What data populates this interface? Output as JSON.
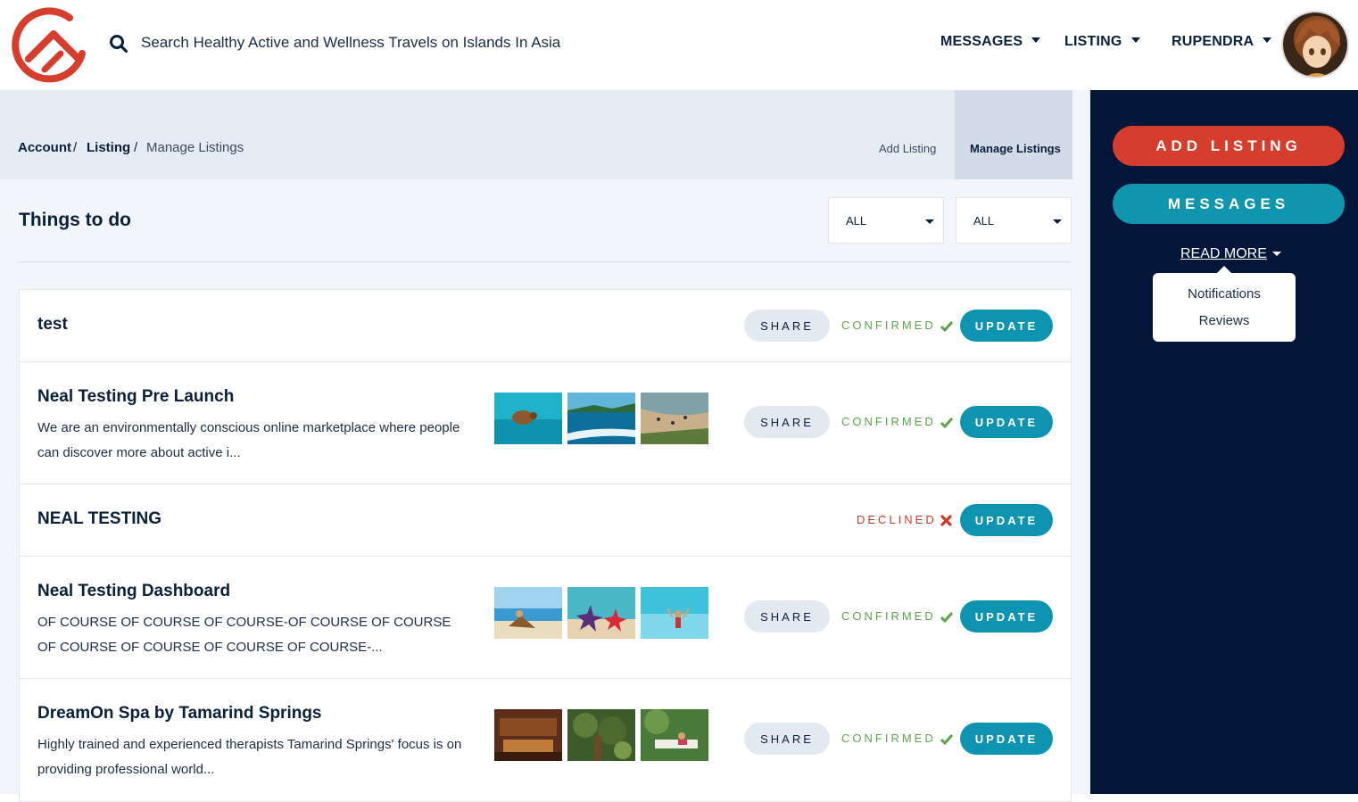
{
  "header": {
    "search_placeholder": "Search Healthy Active and Wellness Travels on Islands In Asia",
    "nav": {
      "messages": "MESSAGES",
      "listing": "LISTING",
      "user": "RUPENDRA"
    }
  },
  "breadcrumb": {
    "account": "Account",
    "listing": "Listing",
    "current": "Manage Listings",
    "sep": "/"
  },
  "tabs": {
    "add": "Add Listing",
    "manage": "Manage Listings"
  },
  "section": {
    "title": "Things to do",
    "filter1": "ALL",
    "filter2": "ALL"
  },
  "labels": {
    "share": "SHARE",
    "update": "UPDATE",
    "confirmed": "CONFIRMED",
    "declined": "DECLINED"
  },
  "listings": [
    {
      "title": "test",
      "status": "CONFIRMED"
    },
    {
      "title": "Neal Testing Pre Launch",
      "desc": "We are an environmentally conscious online marketplace where people can discover more about active i...",
      "status": "CONFIRMED"
    },
    {
      "title": "NEAL TESTING",
      "status": "DECLINED"
    },
    {
      "title": "Neal Testing Dashboard",
      "desc": "OF COURSE OF COURSE OF COURSE-OF COURSE OF COURSE OF COURSE OF COURSE OF COURSE OF COURSE-...",
      "status": "CONFIRMED"
    },
    {
      "title": "DreamOn Spa by Tamarind Springs",
      "desc": "Highly trained and experienced therapists Tamarind Springs' focus is on providing professional world...",
      "status": "CONFIRMED"
    }
  ],
  "sidebar": {
    "add_listing": "ADD LISTING",
    "messages": "MESSAGES",
    "read_more": "READ MORE",
    "menu": [
      "Notifications",
      "Reviews"
    ]
  },
  "colors": {
    "brand_red": "#d53d2d",
    "brand_teal": "#0e94b0",
    "navy": "#031538",
    "confirmed_green": "#5ea34b",
    "declined_red": "#c93a2a"
  }
}
